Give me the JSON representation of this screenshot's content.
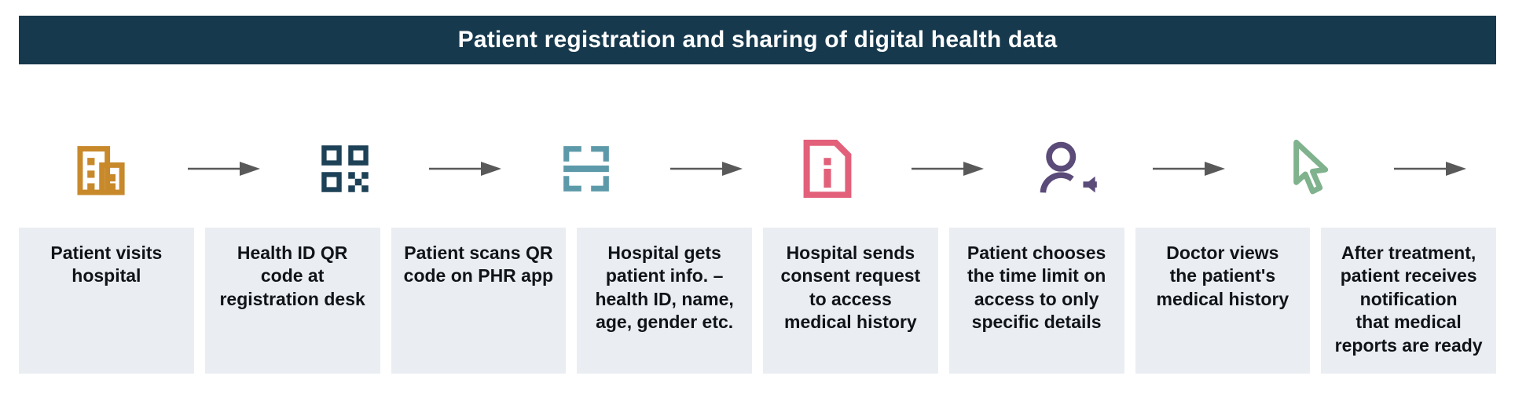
{
  "header": {
    "title": "Patient registration and sharing of digital health data",
    "background_color": "#17394d",
    "text_color": "#ffffff"
  },
  "theme": {
    "page_background": "#ffffff",
    "caption_box_background": "#eaeef2",
    "caption_text_color": "#101418",
    "arrow_color": "#595959"
  },
  "arrow": {
    "name": "right-arrow-connector",
    "color": "#595959"
  },
  "steps": [
    {
      "index": 1,
      "icon": "hospital-building-icon",
      "icon_color": "#c8892b",
      "caption": "Patient visits\nhospital"
    },
    {
      "index": 2,
      "icon": "qr-code-icon",
      "icon_color": "#1d4156",
      "caption": "Health ID QR\ncode at\nregistration desk"
    },
    {
      "index": 3,
      "icon": "qr-scan-frame-icon",
      "icon_color": "#5d9aa9",
      "caption": "Patient scans QR\ncode on PHR app"
    },
    {
      "index": 4,
      "icon": "document-info-icon",
      "icon_color": "#e2607a",
      "caption": "Hospital gets\npatient info. –\nhealth ID, name,\nage, gender etc."
    },
    {
      "index": 5,
      "icon": "person-consent-request-icon",
      "icon_color": "#5b4b79",
      "caption": "Hospital sends\nconsent request\nto access\nmedical history"
    },
    {
      "index": 6,
      "icon": "cursor-pointer-icon",
      "icon_color": "#7fb28d",
      "caption": "Patient chooses\nthe time limit on\naccess to only\nspecific details"
    },
    {
      "index": 7,
      "icon": "clock-history-icon",
      "icon_color": "#d2902d",
      "caption": "Doctor views\nthe patient's\nmedical history"
    },
    {
      "index": 8,
      "icon": "notification-bell-icon",
      "icon_color": "#e2607a",
      "caption": "After treatment,\npatient receives\nnotification\nthat medical\nreports are ready"
    }
  ]
}
